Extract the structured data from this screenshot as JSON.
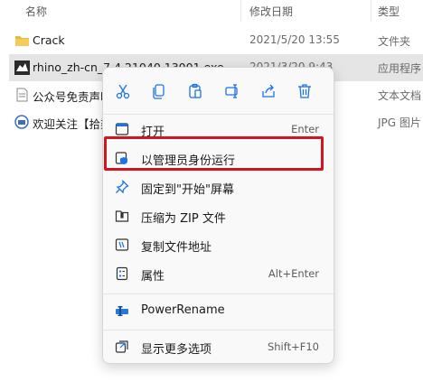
{
  "header": {
    "col_name": "名称",
    "col_date": "修改日期",
    "col_type": "类型"
  },
  "files": [
    {
      "name": "Crack",
      "date": "2021/5/20 13:55",
      "type": "文件夹",
      "icon": "folder-icon"
    },
    {
      "name": "rhino_zh-cn_7.4.21040.13001.exe",
      "date": "2021/3/20 9:43",
      "type": "应用程序",
      "icon": "rhino-app-icon"
    },
    {
      "name": "公众号免责声明.txt",
      "date": "",
      "type": "文本文档",
      "icon": "text-file-icon"
    },
    {
      "name": "欢迎关注【拾柒小栈】.jpg",
      "date": "",
      "type": "JPG 图片",
      "icon": "jpg-file-icon"
    }
  ],
  "context_menu": {
    "quick_actions": [
      "cut-icon",
      "copy-icon",
      "paste-icon",
      "rename-icon",
      "share-icon",
      "delete-icon"
    ],
    "items": [
      {
        "label": "打开",
        "shortcut": "Enter",
        "icon": "open-icon"
      },
      {
        "label": "以管理员身份运行",
        "shortcut": "",
        "icon": "shield-icon"
      },
      {
        "label": "固定到\"开始\"屏幕",
        "shortcut": "",
        "icon": "pin-icon"
      },
      {
        "label": "压缩为 ZIP 文件",
        "shortcut": "",
        "icon": "zip-icon"
      },
      {
        "label": "复制文件地址",
        "shortcut": "",
        "icon": "copy-path-icon"
      },
      {
        "label": "属性",
        "shortcut": "Alt+Enter",
        "icon": "properties-icon"
      },
      {
        "label": "PowerRename",
        "shortcut": "",
        "icon": "powerrename-icon"
      },
      {
        "label": "显示更多选项",
        "shortcut": "Shift+F10",
        "icon": "more-options-icon"
      }
    ]
  },
  "colors": {
    "highlight": "#d0161f",
    "accent": "#1a73e8",
    "folder": "#e8b83a"
  }
}
